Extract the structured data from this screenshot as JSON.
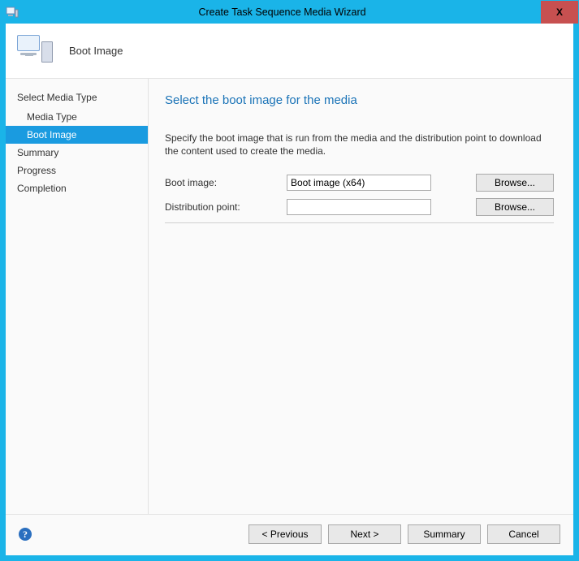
{
  "window": {
    "title": "Create Task Sequence Media Wizard",
    "close_label": "X"
  },
  "header": {
    "page_name": "Boot Image"
  },
  "sidebar": {
    "group": "Select Media Type",
    "items": [
      {
        "label": "Media Type",
        "selected": false
      },
      {
        "label": "Boot Image",
        "selected": true
      },
      {
        "label": "Summary",
        "selected": false
      },
      {
        "label": "Progress",
        "selected": false
      },
      {
        "label": "Completion",
        "selected": false
      }
    ]
  },
  "main": {
    "heading": "Select the boot image for the media",
    "description": "Specify the boot image that is run from the media and the distribution point to download the content used to create the media.",
    "fields": {
      "boot_image": {
        "label": "Boot image:",
        "value": "Boot image (x64)",
        "browse": "Browse..."
      },
      "distribution_point": {
        "label": "Distribution point:",
        "value": "",
        "browse": "Browse..."
      }
    }
  },
  "footer": {
    "help_symbol": "?",
    "previous": "< Previous",
    "next": "Next >",
    "summary": "Summary",
    "cancel": "Cancel"
  }
}
